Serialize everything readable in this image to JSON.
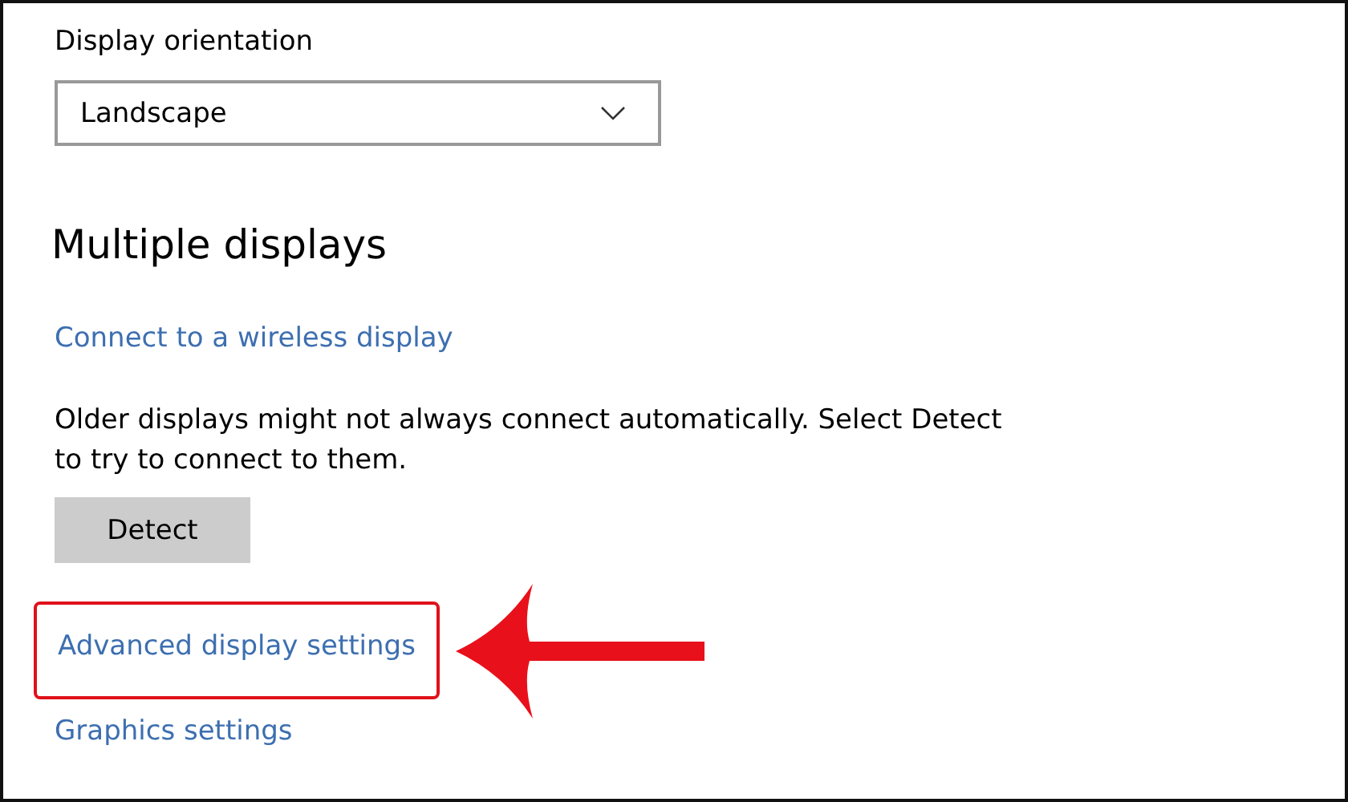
{
  "orientation": {
    "label": "Display orientation",
    "value": "Landscape"
  },
  "section": {
    "title": "Multiple displays"
  },
  "items": [
    {
      "kind": "link",
      "text": "Connect to a wireless display",
      "highlighted": false
    },
    {
      "kind": "paragraph",
      "text": "Older displays might not always connect automatically. Select Detect to try to connect to them."
    },
    {
      "kind": "button",
      "text": "Detect"
    },
    {
      "kind": "link",
      "text": "Advanced display settings",
      "highlighted": true
    },
    {
      "kind": "link",
      "text": "Graphics settings",
      "highlighted": false
    }
  ]
}
